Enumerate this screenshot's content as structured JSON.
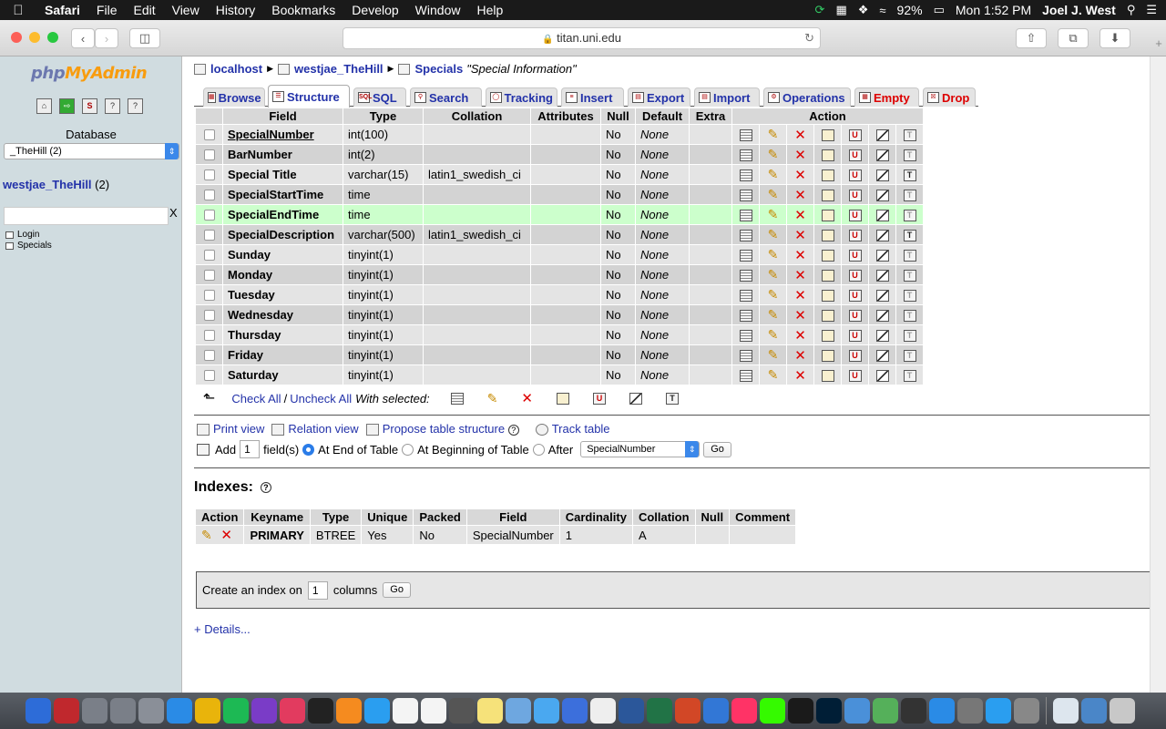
{
  "menubar": {
    "app": "Safari",
    "items": [
      "File",
      "Edit",
      "View",
      "History",
      "Bookmarks",
      "Develop",
      "Window",
      "Help"
    ],
    "battery": "92%",
    "clock": "Mon 1:52 PM",
    "user": "Joel J. West"
  },
  "browser": {
    "url": "titan.uni.edu"
  },
  "sidebar": {
    "logo_php": "php",
    "logo_myadmin": "MyAdmin",
    "icons": [
      "home-icon",
      "exit-icon",
      "sql-icon",
      "query-icon",
      "docs-icon"
    ],
    "database_label": "Database",
    "database_select": "_TheHill (2)",
    "db_name": "westjae_TheHill",
    "db_count": "(2)",
    "filter_clear": "X",
    "tables": [
      "Login",
      "Specials"
    ]
  },
  "breadcrumb": {
    "server": "localhost",
    "database": "westjae_TheHill",
    "table": "Specials",
    "comment": "\"Special Information\""
  },
  "tabs": [
    {
      "label": "Browse",
      "active": false,
      "danger": false
    },
    {
      "label": "Structure",
      "active": true,
      "danger": false
    },
    {
      "label": "SQL",
      "active": false,
      "danger": false
    },
    {
      "label": "Search",
      "active": false,
      "danger": false
    },
    {
      "label": "Tracking",
      "active": false,
      "danger": false
    },
    {
      "label": "Insert",
      "active": false,
      "danger": false
    },
    {
      "label": "Export",
      "active": false,
      "danger": false
    },
    {
      "label": "Import",
      "active": false,
      "danger": false
    },
    {
      "label": "Operations",
      "active": false,
      "danger": false
    },
    {
      "label": "Empty",
      "active": false,
      "danger": true
    },
    {
      "label": "Drop",
      "active": false,
      "danger": true
    }
  ],
  "structure": {
    "columns": [
      "Field",
      "Type",
      "Collation",
      "Attributes",
      "Null",
      "Default",
      "Extra",
      "Action"
    ],
    "rows": [
      {
        "field": "SpecialNumber",
        "type": "int(100)",
        "collation": "",
        "attributes": "",
        "null": "No",
        "default": "None",
        "extra": "",
        "primary": true,
        "fulltext": false
      },
      {
        "field": "BarNumber",
        "type": "int(2)",
        "collation": "",
        "attributes": "",
        "null": "No",
        "default": "None",
        "extra": "",
        "primary": false,
        "fulltext": false
      },
      {
        "field": "Special Title",
        "type": "varchar(15)",
        "collation": "latin1_swedish_ci",
        "attributes": "",
        "null": "No",
        "default": "None",
        "extra": "",
        "primary": false,
        "fulltext": true
      },
      {
        "field": "SpecialStartTime",
        "type": "time",
        "collation": "",
        "attributes": "",
        "null": "No",
        "default": "None",
        "extra": "",
        "primary": false,
        "fulltext": false
      },
      {
        "field": "SpecialEndTime",
        "type": "time",
        "collation": "",
        "attributes": "",
        "null": "No",
        "default": "None",
        "extra": "",
        "primary": false,
        "fulltext": false,
        "highlight": true
      },
      {
        "field": "SpecialDescription",
        "type": "varchar(500)",
        "collation": "latin1_swedish_ci",
        "attributes": "",
        "null": "No",
        "default": "None",
        "extra": "",
        "primary": false,
        "fulltext": true
      },
      {
        "field": "Sunday",
        "type": "tinyint(1)",
        "collation": "",
        "attributes": "",
        "null": "No",
        "default": "None",
        "extra": "",
        "primary": false,
        "fulltext": false
      },
      {
        "field": "Monday",
        "type": "tinyint(1)",
        "collation": "",
        "attributes": "",
        "null": "No",
        "default": "None",
        "extra": "",
        "primary": false,
        "fulltext": false
      },
      {
        "field": "Tuesday",
        "type": "tinyint(1)",
        "collation": "",
        "attributes": "",
        "null": "No",
        "default": "None",
        "extra": "",
        "primary": false,
        "fulltext": false
      },
      {
        "field": "Wednesday",
        "type": "tinyint(1)",
        "collation": "",
        "attributes": "",
        "null": "No",
        "default": "None",
        "extra": "",
        "primary": false,
        "fulltext": false
      },
      {
        "field": "Thursday",
        "type": "tinyint(1)",
        "collation": "",
        "attributes": "",
        "null": "No",
        "default": "None",
        "extra": "",
        "primary": false,
        "fulltext": false
      },
      {
        "field": "Friday",
        "type": "tinyint(1)",
        "collation": "",
        "attributes": "",
        "null": "No",
        "default": "None",
        "extra": "",
        "primary": false,
        "fulltext": false
      },
      {
        "field": "Saturday",
        "type": "tinyint(1)",
        "collation": "",
        "attributes": "",
        "null": "No",
        "default": "None",
        "extra": "",
        "primary": false,
        "fulltext": false
      }
    ],
    "row_actions": [
      "browse-distinct-icon",
      "edit-icon",
      "drop-icon",
      "primary-icon",
      "unique-icon",
      "index-icon",
      "fulltext-icon"
    ]
  },
  "with_selected": {
    "check_all": "Check All",
    "separator": "/",
    "uncheck_all": "Uncheck All",
    "label": "With selected:"
  },
  "view_links": {
    "print_view": "Print view",
    "relation_view": "Relation view",
    "propose": "Propose table structure",
    "track": "Track table"
  },
  "add_fields": {
    "add": "Add",
    "count": "1",
    "fields": "field(s)",
    "at_end": "At End of Table",
    "at_beginning": "At Beginning of Table",
    "after": "After",
    "after_field": "SpecialNumber",
    "go": "Go"
  },
  "indexes": {
    "title": "Indexes:",
    "columns": [
      "Action",
      "Keyname",
      "Type",
      "Unique",
      "Packed",
      "Field",
      "Cardinality",
      "Collation",
      "Null",
      "Comment"
    ],
    "rows": [
      {
        "keyname": "PRIMARY",
        "type": "BTREE",
        "unique": "Yes",
        "packed": "No",
        "field": "SpecialNumber",
        "cardinality": "1",
        "collation": "A",
        "null": "",
        "comment": ""
      }
    ]
  },
  "create_index": {
    "prefix": "Create an index on",
    "count": "1",
    "suffix": "columns",
    "go": "Go"
  },
  "details": "+ Details...",
  "dock": [
    "Finder",
    "FileZilla",
    "Automator",
    "Automator",
    "Launchpad",
    "Safari",
    "Chrome",
    "Spotify",
    "Podcasts",
    "iTunes",
    "Terminal",
    "iBooks",
    "App Store",
    "Reminders",
    "Calendar",
    "Image Capture",
    "Notes",
    "Preview",
    "Messages",
    "Editor",
    "Preview",
    "Word",
    "Excel",
    "PowerPoint",
    "Keynote",
    "InDesign",
    "Dreamweaver",
    "Word Processor",
    "Photoshop",
    "Xcode",
    "Maps",
    "Photo Booth",
    "Safari",
    "Utility",
    "App Store",
    "System Preferences",
    "Documents",
    "Downloads",
    "Trash"
  ],
  "dock_colors": [
    "#2d6cd8",
    "#c0282d",
    "#7a7f88",
    "#7a7f88",
    "#8a8f98",
    "#2a8be6",
    "#e9b40b",
    "#1db954",
    "#7a3cc7",
    "#e23b5f",
    "#222222",
    "#f58b1f",
    "#2a9ef0",
    "#f4f4f4",
    "#f4f4f4",
    "#555555",
    "#f6e27a",
    "#6ea7e0",
    "#4aa8f0",
    "#3c6fdc",
    "#eeeeee",
    "#2b579a",
    "#217346",
    "#d24726",
    "#3277d6",
    "#ff3366",
    "#35fa00",
    "#1a1a1a",
    "#001e36",
    "#4a90d9",
    "#55b05a",
    "#333333",
    "#2a8be6",
    "#777777",
    "#2a9ef0",
    "#888888",
    "#dde6ee",
    "#4a86c8",
    "#c8c8c8"
  ]
}
